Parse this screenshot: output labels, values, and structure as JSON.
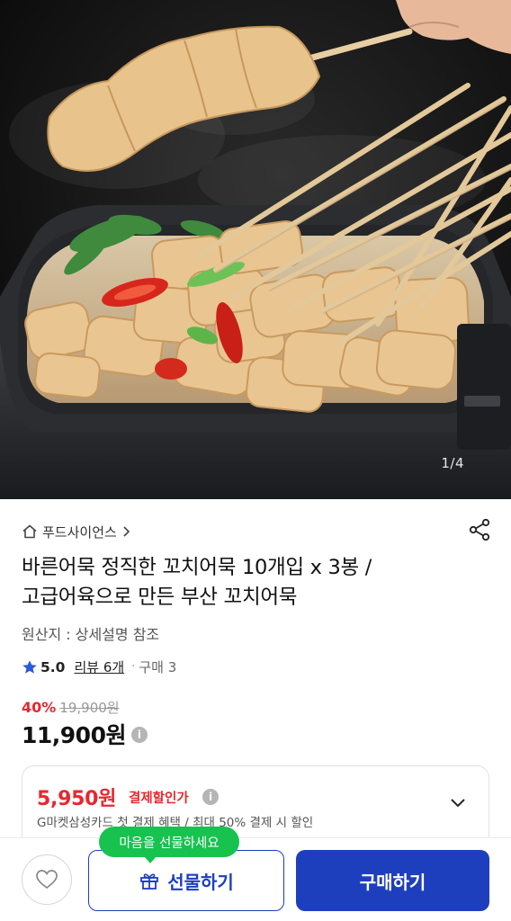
{
  "hero": {
    "image_counter": "1/4",
    "subject": "꼬치어묵"
  },
  "product": {
    "seller": "푸드사이언스",
    "title_line1": "바른어묵 정직한 꼬치어묵 10개입 x 3봉 /",
    "title_line2": "고급어육으로 만든 부산 꼬치어묵",
    "origin": "원산지 : 상세설명 참조",
    "rating": "5.0",
    "reviews": "리뷰 6개",
    "sold": "구매 3",
    "discount_rate": "40%",
    "original_price": "19,900원",
    "price": "11,900원"
  },
  "card_discount": {
    "price": "5,950원",
    "label": "결제할인가",
    "description": "G마켓삼성카드 첫 결제 혜택 / 최대 50% 결제 시 할인"
  },
  "bottom": {
    "tooltip": "마음을 선물하세요",
    "gift_label": "선물하기",
    "buy_label": "구매하기"
  },
  "colors": {
    "accent_blue": "#1e3fbd",
    "discount_red": "#e8272e",
    "tooltip_green": "#17c24f"
  }
}
